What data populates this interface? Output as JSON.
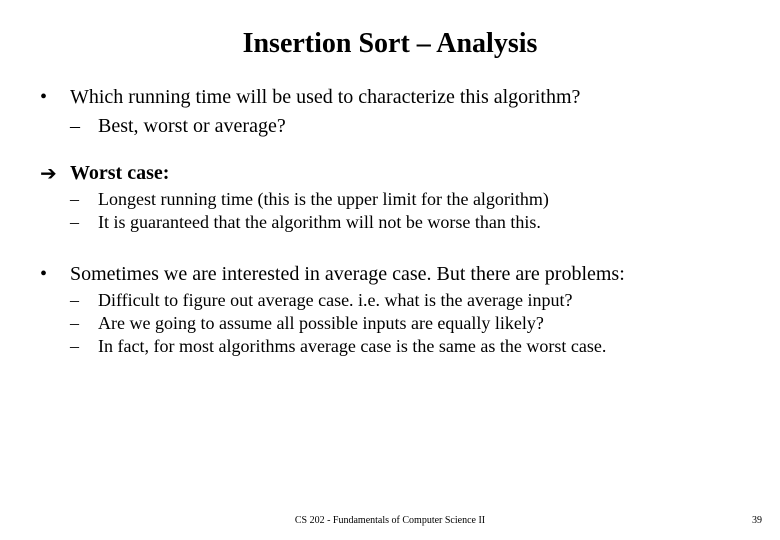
{
  "title": "Insertion Sort – Analysis",
  "b1": {
    "text": "Which running time will be used to characterize this algorithm?",
    "sub1": "Best, worst or average?"
  },
  "b2": {
    "label": "Worst case:",
    "sub1": "Longest running time (this is the upper limit for the algorithm)",
    "sub2": "It is guaranteed that the algorithm will not be worse than this."
  },
  "b3": {
    "text": "Sometimes we are interested in average case. But there are problems:",
    "sub1": "Difficult to figure out average case. i.e. what is the average input?",
    "sub2": "Are we going to assume all possible inputs are equally likely?",
    "sub3": "In fact, for most algorithms average case is the same as the worst case."
  },
  "footer": "CS 202 - Fundamentals of Computer Science II",
  "page": "39"
}
